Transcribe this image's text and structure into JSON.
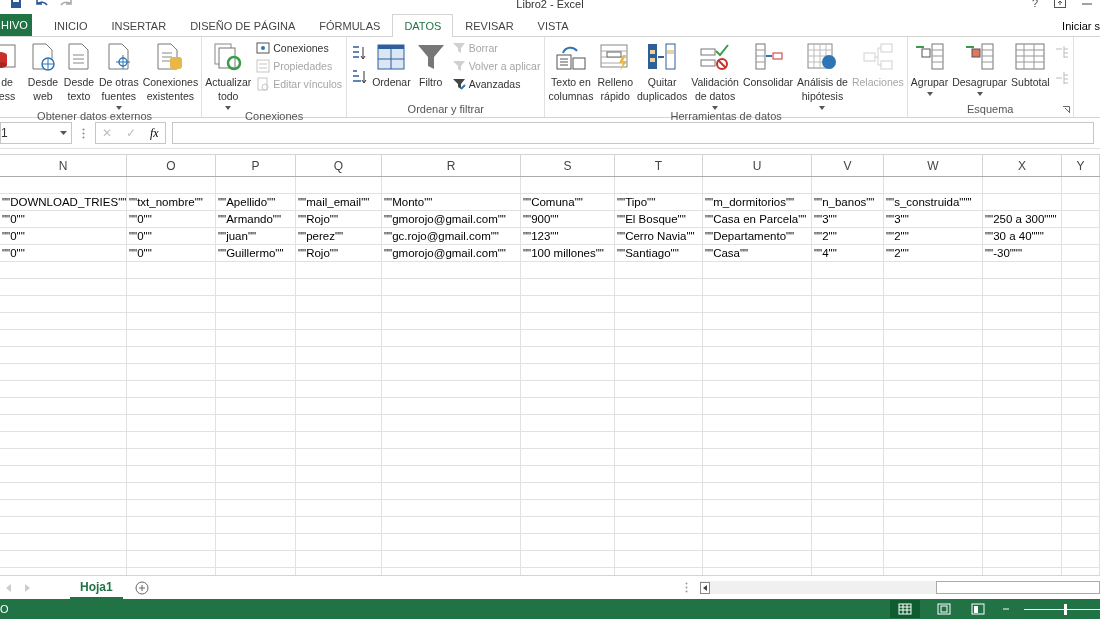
{
  "window": {
    "title": "Libro2 - Excel",
    "help": "?"
  },
  "tabs": [
    {
      "label": "HIVO",
      "kind": "file",
      "selected": false
    },
    {
      "label": "INICIO",
      "kind": "tab",
      "selected": false
    },
    {
      "label": "INSERTAR",
      "kind": "tab",
      "selected": false
    },
    {
      "label": "DISEÑO DE PÁGINA",
      "kind": "tab",
      "selected": false
    },
    {
      "label": "FÓRMULAS",
      "kind": "tab",
      "selected": false
    },
    {
      "label": "DATOS",
      "kind": "tab",
      "selected": true
    },
    {
      "label": "REVISAR",
      "kind": "tab",
      "selected": false
    },
    {
      "label": "VISTA",
      "kind": "tab",
      "selected": false
    }
  ],
  "account": "Iniciar s",
  "ribbon": [
    {
      "label": "Obtener datos externos",
      "items": [
        {
          "kind": "large",
          "lines": [
            "de",
            "ess"
          ],
          "disabled": false,
          "dropdown": false
        },
        {
          "kind": "large",
          "lines": [
            "Desde",
            "web"
          ],
          "disabled": false,
          "dropdown": false
        },
        {
          "kind": "large",
          "lines": [
            "Desde",
            "texto"
          ],
          "disabled": false,
          "dropdown": false
        },
        {
          "kind": "large",
          "lines": [
            "De otras",
            "fuentes"
          ],
          "disabled": false,
          "dropdown": true
        },
        {
          "kind": "large",
          "lines": [
            "Conexiones",
            "existentes"
          ],
          "disabled": false,
          "dropdown": false
        }
      ]
    },
    {
      "label": "Conexiones",
      "items": [
        {
          "kind": "large",
          "lines": [
            "Actualizar",
            "todo"
          ],
          "disabled": false,
          "dropdown": true
        },
        {
          "kind": "stack",
          "items": [
            {
              "label": "Conexiones",
              "disabled": false
            },
            {
              "label": "Propiedades",
              "disabled": true
            },
            {
              "label": "Editar vínculos",
              "disabled": true
            }
          ]
        }
      ]
    },
    {
      "label": "Ordenar y filtrar",
      "items": [
        {
          "kind": "icons"
        },
        {
          "kind": "large",
          "lines": [
            "Ordenar"
          ],
          "disabled": false,
          "dropdown": false
        },
        {
          "kind": "large",
          "lines": [
            "Filtro"
          ],
          "disabled": false,
          "dropdown": false
        },
        {
          "kind": "stack",
          "items": [
            {
              "label": "Borrar",
              "disabled": true
            },
            {
              "label": "Volver a aplicar",
              "disabled": true
            },
            {
              "label": "Avanzadas",
              "disabled": false
            }
          ]
        }
      ]
    },
    {
      "label": "Herramientas de datos",
      "items": [
        {
          "kind": "large",
          "lines": [
            "Texto en",
            "columnas"
          ],
          "disabled": false,
          "dropdown": false
        },
        {
          "kind": "large",
          "lines": [
            "Relleno",
            "rápido"
          ],
          "disabled": false,
          "dropdown": false
        },
        {
          "kind": "large",
          "lines": [
            "Quitar",
            "duplicados"
          ],
          "disabled": false,
          "dropdown": false
        },
        {
          "kind": "large",
          "lines": [
            "Validación",
            "de datos"
          ],
          "disabled": false,
          "dropdown": true
        },
        {
          "kind": "large",
          "lines": [
            "Consolidar"
          ],
          "disabled": false,
          "dropdown": false
        },
        {
          "kind": "large",
          "lines": [
            "Análisis de",
            "hipótesis"
          ],
          "disabled": false,
          "dropdown": true
        },
        {
          "kind": "large",
          "lines": [
            "Relaciones"
          ],
          "disabled": true,
          "dropdown": false
        }
      ]
    },
    {
      "label": "Esquema",
      "launcher": true,
      "items": [
        {
          "kind": "large",
          "lines": [
            "Agrupar"
          ],
          "disabled": false,
          "dropdown": true
        },
        {
          "kind": "large",
          "lines": [
            "Desagrupar"
          ],
          "disabled": false,
          "dropdown": true
        },
        {
          "kind": "large",
          "lines": [
            "Subtotal"
          ],
          "disabled": false,
          "dropdown": false
        },
        {
          "kind": "icons2"
        }
      ]
    }
  ],
  "formula_bar": {
    "name_box": "1",
    "cancel": "✕",
    "enter": "✓",
    "fx": "fx"
  },
  "sheet": {
    "columns": [
      "N",
      "O",
      "P",
      "Q",
      "R",
      "S",
      "T",
      "U",
      "V",
      "W",
      "X",
      "Y"
    ],
    "rows": [
      [
        "\"\"DOWNLOAD_TRIES\"\"",
        "\"\"txt_nombre\"\"",
        "\"\"Apellido\"\"",
        "\"\"mail_email\"\"",
        "\"\"Monto\"\"",
        "\"\"Comuna\"\"",
        "\"\"Tipo\"\"",
        "\"\"m_dormitorios\"\"",
        "\"\"n_banos\"\"",
        "\"\"s_construida\"\"\"",
        null,
        null
      ],
      [
        "\"\"0\"\"",
        "\"\"0\"\"",
        "\"\"Armando\"\"",
        "\"\"Rojo\"\"",
        "\"\"gmorojo@gmail.com\"\"",
        "\"\"900\"\"",
        "\"\"El Bosque\"\"",
        "\"\"Casa en Parcela\"\"",
        "\"\"3\"\"",
        "\"\"3\"\"",
        "\"\"250 a 300\"\"\"",
        null
      ],
      [
        "\"\"0\"\"",
        "\"\"0\"\"",
        "\"\"juan\"\"",
        "\"\"perez\"\"",
        "\"\"gc.rojo@gmail.com\"\"",
        "\"\"123\"\"",
        "\"\"Cerro Navia\"\"",
        "\"\"Departamento\"\"",
        "\"\"2\"\"",
        "\"\"2\"\"",
        "\"\"30 a 40\"\"\"",
        null
      ],
      [
        "\"\"0\"\"",
        "\"\"0\"\"",
        "\"\"Guillermo\"\"",
        "\"\"Rojo\"\"",
        "\"\"gmorojo@gmail.com\"\"",
        "\"\"100 millones\"\"",
        "\"\"Santiago\"\"",
        "\"\"Casa\"\"",
        "\"\"4\"\"",
        "\"\"2\"\"",
        "\"\"-30\"\"\"",
        null
      ]
    ]
  },
  "sheet_tabs": [
    {
      "label": "Hoja1",
      "selected": true
    }
  ],
  "status_bar": {
    "text": "O",
    "zoom": {
      "level": 0.5
    }
  }
}
